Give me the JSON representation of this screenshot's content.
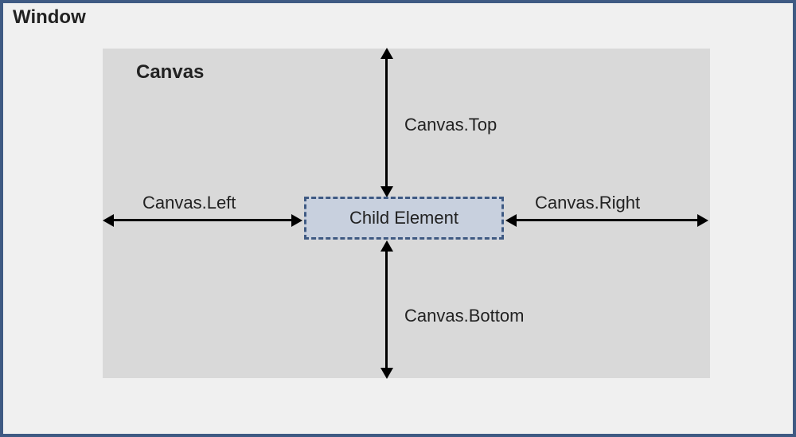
{
  "window": {
    "label": "Window"
  },
  "canvas": {
    "label": "Canvas"
  },
  "child": {
    "label": "Child Element"
  },
  "arrows": {
    "top": "Canvas.Top",
    "left": "Canvas.Left",
    "right": "Canvas.Right",
    "bottom": "Canvas.Bottom"
  },
  "colors": {
    "frame_border": "#3f5a83",
    "window_bg": "#f0f0f0",
    "canvas_bg": "#d9d9d9",
    "child_bg": "#c8d0de",
    "child_border": "#3f5a83",
    "arrow": "#000000"
  }
}
